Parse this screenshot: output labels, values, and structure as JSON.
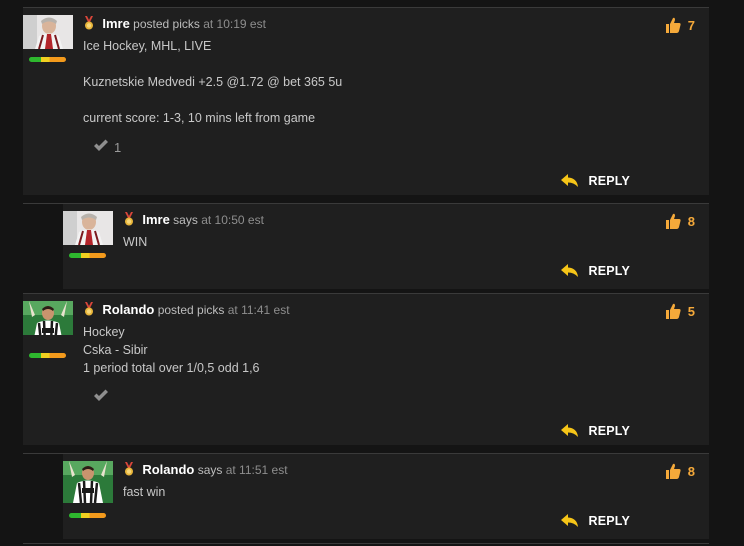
{
  "comments": [
    {
      "user": "Imre",
      "action": "posted picks",
      "time": "at 10:19 est",
      "likes": "7",
      "lines": [
        "Ice Hockey, MHL, LIVE",
        "Kuznetskie Medvedi +2.5 @1.72 @ bet 365 5u",
        "current score: 1-3, 10 mins left from game"
      ],
      "check_count": "1",
      "reply_label": "REPLY"
    },
    {
      "user": "Imre",
      "action": "says",
      "time": "at 10:50 est",
      "likes": "8",
      "lines": [
        "WIN"
      ],
      "reply_label": "REPLY"
    },
    {
      "user": "Rolando",
      "action": "posted picks",
      "time": "at 11:41 est",
      "likes": "5",
      "lines": [
        "Hockey",
        "Cska - Sibir",
        "1 period total over 1/0,5 odd 1,6"
      ],
      "check_count": "",
      "reply_label": "REPLY"
    },
    {
      "user": "Rolando",
      "action": "says",
      "time": "at 11:51 est",
      "likes": "8",
      "lines": [
        "fast win"
      ],
      "reply_label": "REPLY"
    }
  ],
  "colors": {
    "background": "#141414",
    "panel": "#1f1f1f",
    "like": "#f5a93a",
    "reply_arrow": "#f5c518"
  }
}
